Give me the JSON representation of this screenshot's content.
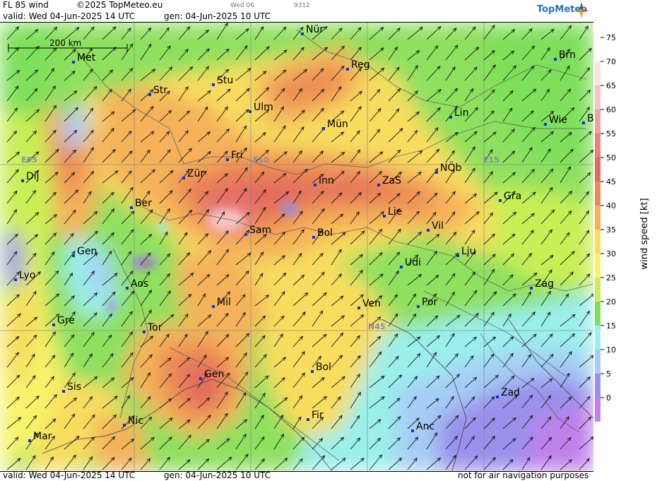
{
  "header": {
    "product": "FL 85 wind",
    "copyright": "©2025 TopMeteo.eu",
    "valid": "valid:  Wed  04-Jun-2025  14 UTC",
    "gen": "gen: 04-Jun-2025 10 UTC",
    "day_tab": "Wed 06",
    "code": "9312",
    "brand": "TopMeteo"
  },
  "footer": {
    "valid": "valid:  Wed  04-Jun-2025  14 UTC",
    "gen": "gen: 04-Jun-2025 10 UTC",
    "disclaimer": "not for air navigation purposes"
  },
  "scale_bar": "200 km",
  "grid_labels": [
    "E05",
    "E10",
    "E15",
    "N45"
  ],
  "cities": [
    "Nür",
    "Met",
    "Reg",
    "Brn",
    "Stu",
    "Str",
    "Ulm",
    "Mün",
    "Lin",
    "Wie",
    "B",
    "Fri",
    "Dij",
    "Zür",
    "Inn",
    "ZaS",
    "NÖb",
    "Gra",
    "Ber",
    "Lie",
    "Vil",
    "Sam",
    "Bol",
    "Gen",
    "Lju",
    "Lyo",
    "Aos",
    "Udi",
    "Zag",
    "Mil",
    "Ven",
    "Por",
    "Gre",
    "Tor",
    "Gen",
    "Bol",
    "Sis",
    "Zad",
    "Nic",
    "Fir",
    "Anc",
    "Mar"
  ],
  "legend": {
    "title": "wind speed [kt]",
    "ticks": [
      "75",
      "70",
      "65",
      "60",
      "55",
      "50",
      "45",
      "40",
      "35",
      "30",
      "25",
      "20",
      "15",
      "10",
      "5",
      "0"
    ],
    "colors": [
      "#ffffff",
      "#fbe3e3",
      "#f6c3c3",
      "#f0a0a0",
      "#ea8080",
      "#e36a5e",
      "#ec8a55",
      "#f5b25a",
      "#f8dd5e",
      "#f7f36a",
      "#c8ef55",
      "#7ee05a",
      "#9af0ec",
      "#a6cdf5",
      "#9a90ec",
      "#c080ec"
    ]
  }
}
